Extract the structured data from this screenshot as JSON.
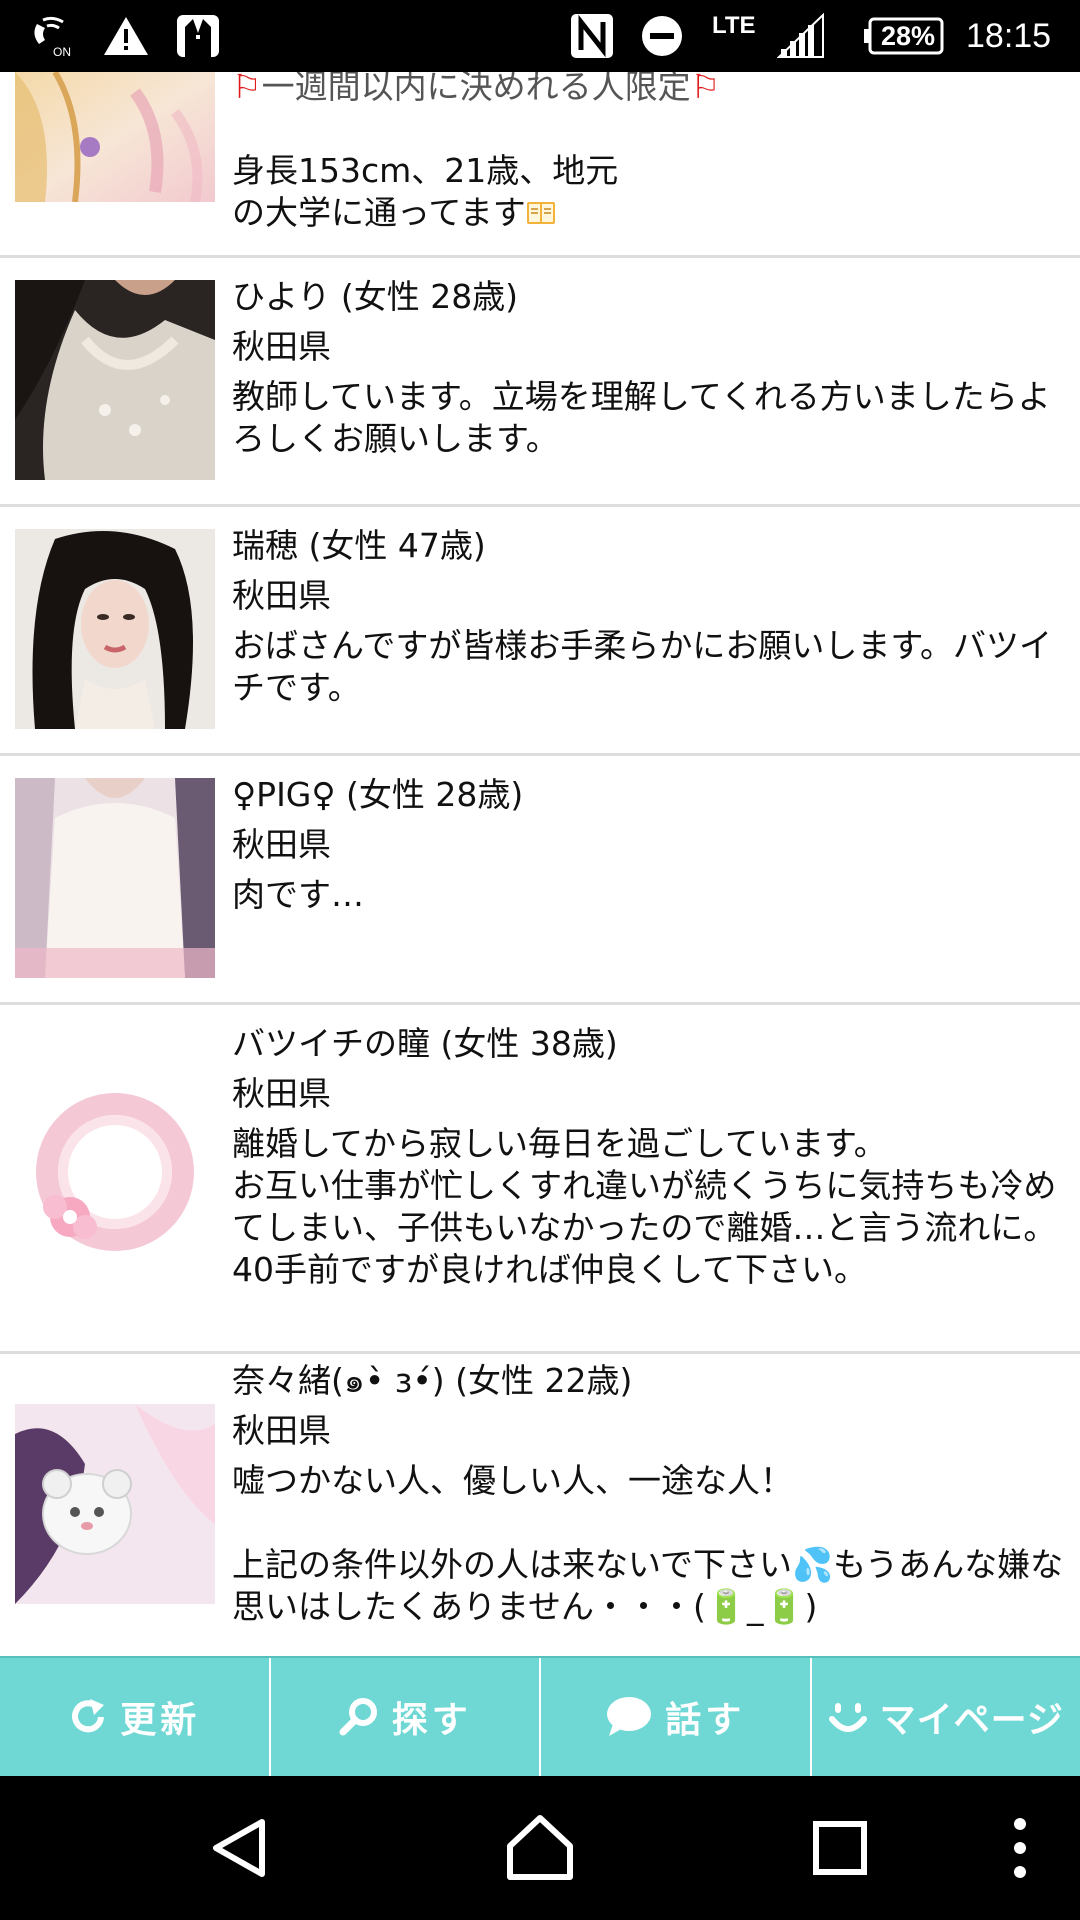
{
  "status_bar": {
    "lte": "LTE",
    "battery": "28%",
    "time": "18:15",
    "icons": [
      "wifi-calling-on-icon",
      "warning-icon",
      "tuxedo-app-icon",
      "nfc-icon",
      "do-not-disturb-icon",
      "signal-icon",
      "battery-icon"
    ]
  },
  "posts": [
    {
      "avatar": "anime-illustration",
      "title": "一週間以内に決めれる人限定",
      "line1": "身長153cm、21歳、地元",
      "line2": "の大学に通ってます"
    },
    {
      "avatar": "photo-white-lace-top",
      "name": "ひより (女性 28歳)",
      "prefecture": "秋田県",
      "message": "教師しています。立場を理解してくれる方いましたらよろしくお願いします。"
    },
    {
      "avatar": "photo-woman-portrait",
      "name": "瑞穂 (女性 47歳)",
      "prefecture": "秋田県",
      "message": "おばさんですが皆様お手柔らかにお願いします。バツイチです。"
    },
    {
      "avatar": "photo-white-tank-top",
      "name": "♀PIG♀ (女性 28歳)",
      "prefecture": "秋田県",
      "message": "肉です…"
    },
    {
      "avatar": "pink-swirl-flower-illustration",
      "name": "バツイチの瞳 (女性 38歳)",
      "prefecture": "秋田県",
      "message": "離婚してから寂しい毎日を過ごしています。\nお互い仕事が忙しくすれ違いが続くうちに気持ちも冷めてしまい、子供もいなかったので離婚…と言う流れに。\n40手前ですが良ければ仲良くして下さい。"
    },
    {
      "avatar": "photo-pink-with-animal-sticker",
      "name": "奈々緒(๑•̀ з•́) (女性 22歳)",
      "prefecture": "秋田県",
      "message": "嘘つかない人、優しい人、一途な人！\n\n上記の条件以外の人は来ないで下さい💦もうあんな嫌な思いはしたくありません・・・(🔋_🔋)"
    }
  ],
  "bottom_nav": [
    {
      "label": "更新",
      "icon": "refresh-icon"
    },
    {
      "label": "探す",
      "icon": "search-icon"
    },
    {
      "label": "話す",
      "icon": "chat-bubble-icon"
    },
    {
      "label": "マイページ",
      "icon": "smiley-icon"
    }
  ],
  "system_nav": {
    "buttons": [
      "back-icon",
      "home-icon",
      "recents-icon",
      "more-icon"
    ]
  },
  "colors": {
    "nav_background": "#6fd8d4",
    "divider": "#dddddd",
    "status_bar": "#000000"
  }
}
